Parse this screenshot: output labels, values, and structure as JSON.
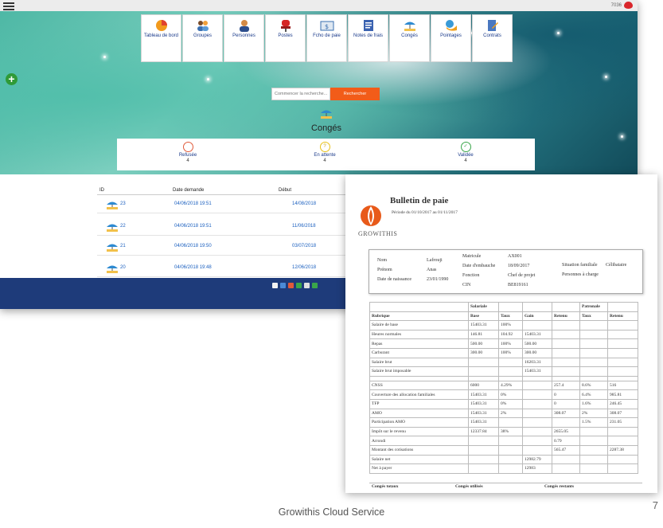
{
  "app": {
    "topbar": {
      "right_text": "7036"
    },
    "modules": [
      {
        "label": "Tableau de bord",
        "icon": "pie-chart-icon"
      },
      {
        "label": "Groupes",
        "icon": "group-icon"
      },
      {
        "label": "Personnes",
        "icon": "person-icon"
      },
      {
        "label": "Postes",
        "icon": "chair-icon"
      },
      {
        "label": "Fcho de paie",
        "icon": "payslip-icon"
      },
      {
        "label": "Notes de frais",
        "icon": "receipt-icon"
      },
      {
        "label": "Congés",
        "icon": "beach-icon"
      },
      {
        "label": "Pointages",
        "icon": "clock-icon"
      },
      {
        "label": "Contrats",
        "icon": "contract-icon"
      }
    ],
    "search": {
      "placeholder": "Commencer la recherche...",
      "button": "Rechercher"
    },
    "section_title": "Congés",
    "statuses": [
      {
        "symbol": "",
        "label": "Refusée",
        "count": "4",
        "color": "#e05a3a"
      },
      {
        "symbol": "?",
        "label": "En attente",
        "count": "4",
        "color": "#e8c21a"
      },
      {
        "symbol": "✓",
        "label": "Validée",
        "count": "4",
        "color": "#3aa64a"
      }
    ],
    "table": {
      "headers": [
        "ID",
        "Date demande",
        "Début"
      ],
      "rows": [
        {
          "id": "23",
          "date": "04/06/2018 19:51",
          "debut": "14/08/2018"
        },
        {
          "id": "22",
          "date": "04/06/2018 19:51",
          "debut": "11/06/2018"
        },
        {
          "id": "21",
          "date": "04/06/2018 19:50",
          "debut": "03/07/2018"
        },
        {
          "id": "20",
          "date": "04/06/2018 19:48",
          "debut": "12/06/2018"
        }
      ]
    }
  },
  "payslip": {
    "title": "Bulletin de paie",
    "period": "Période du 01/10/2017 au 01/11/2017",
    "logo_text": "GROWITHIS",
    "employee": {
      "nom_label": "Nom",
      "nom": "Lafrouji",
      "prenom_label": "Prénom",
      "prenom": "Anas",
      "naissance_label": "Date de naissance",
      "naissance": "23/01/1990",
      "matricule_label": "Matricule",
      "matricule": "AX001",
      "embauche_label": "Date d'embauche",
      "embauche": "18/09/2017",
      "fonction_label": "Fonction",
      "fonction": "Chef de projet",
      "cin_label": "CIN",
      "cin": "BE819161",
      "situation_label": "Situation familiale",
      "situation": "Célibataire",
      "charge_label": "Personnes à charge",
      "charge": ""
    },
    "group_headers": {
      "salariale": "Salariale",
      "patronale": "Patronale"
    },
    "headers": [
      "Rubrique",
      "Base",
      "Taux",
      "Gain",
      "Retenu",
      "Taux",
      "Retenu"
    ],
    "rows_a": [
      [
        "Salaire de base",
        "15403.31",
        "100%",
        "",
        "",
        "",
        ""
      ],
      [
        "Heures normales",
        "146.81",
        "104.92",
        "15403.31",
        "",
        "",
        ""
      ],
      [
        "Repas",
        "500.00",
        "100%",
        "500.00",
        "",
        "",
        ""
      ],
      [
        "Carburant",
        "300.00",
        "100%",
        "300.00",
        "",
        "",
        ""
      ],
      [
        "Salaire brut",
        "",
        "",
        "16203.31",
        "",
        "",
        ""
      ],
      [
        "Salaire brut imposable",
        "",
        "",
        "15403.31",
        "",
        "",
        ""
      ]
    ],
    "rows_b": [
      [
        "CNSS",
        "6000",
        "4.29%",
        "",
        "257.4",
        "8.6%",
        "516"
      ],
      [
        "Couverture des allocation familiales",
        "15403.31",
        "0%",
        "",
        "0",
        "6.4%",
        "985.81"
      ],
      [
        "TFP",
        "15403.31",
        "0%",
        "",
        "0",
        "1.6%",
        "246.45"
      ],
      [
        "AMO",
        "15403.31",
        "2%",
        "",
        "308.07",
        "2%",
        "308.07"
      ],
      [
        "Participation AMO",
        "15403.31",
        "",
        "",
        "",
        "1.5%",
        "231.05"
      ],
      [
        "Impôt sur le revenu",
        "12337.84",
        "38%",
        "",
        "2655.05",
        "",
        ""
      ],
      [
        "Arrondi",
        "",
        "",
        "",
        "0.79",
        "",
        ""
      ],
      [
        "Montant des cotisations",
        "",
        "",
        "",
        "565.47",
        "",
        "2287.38"
      ],
      [
        "Salaire net",
        "",
        "",
        "12982.79",
        "",
        "",
        ""
      ],
      [
        "Net à payer",
        "",
        "",
        "12983",
        "",
        "",
        ""
      ]
    ],
    "conges": [
      "Congés totaux",
      "Congés utilisés",
      "Congés restants"
    ]
  },
  "footer": {
    "text": "Growithis Cloud Service",
    "page": "7"
  }
}
